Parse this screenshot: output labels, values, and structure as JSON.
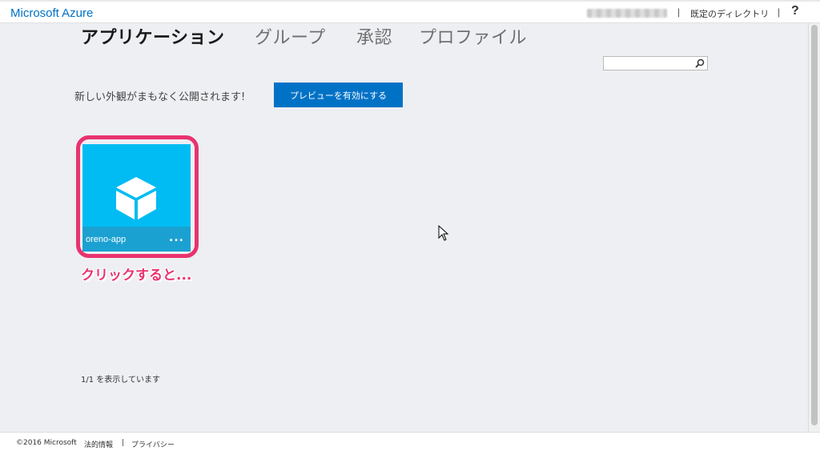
{
  "header": {
    "brand": "Microsoft Azure",
    "separator": "|",
    "directory_link": "既定のディレクトリ",
    "help_label": "?"
  },
  "nav": {
    "tabs": [
      {
        "label": "アプリケーション",
        "active": true
      },
      {
        "label": "グループ",
        "active": false
      },
      {
        "label": "承認",
        "active": false
      },
      {
        "label": "プロファイル",
        "active": false
      }
    ]
  },
  "search": {
    "placeholder": "",
    "icon": "search-icon"
  },
  "notice": {
    "text": "新しい外観がまもなく公開されます!",
    "button_label": "プレビューを有効にする"
  },
  "apps": [
    {
      "name": "oreno-app",
      "icon": "cube-icon",
      "more_label": "..."
    }
  ],
  "annotation": {
    "callout_text": "クリックすると..."
  },
  "list_status": "1/1 を表示しています",
  "footer": {
    "copyright": "©2016 Microsoft",
    "legal": "法的情報",
    "separator": "|",
    "privacy": "プライバシー"
  },
  "colors": {
    "brand": "#0072c6",
    "tile": "#00bcf2",
    "tile_footer": "#1ba1d1",
    "highlight": "#e8336f",
    "background": "#eeeff3"
  }
}
